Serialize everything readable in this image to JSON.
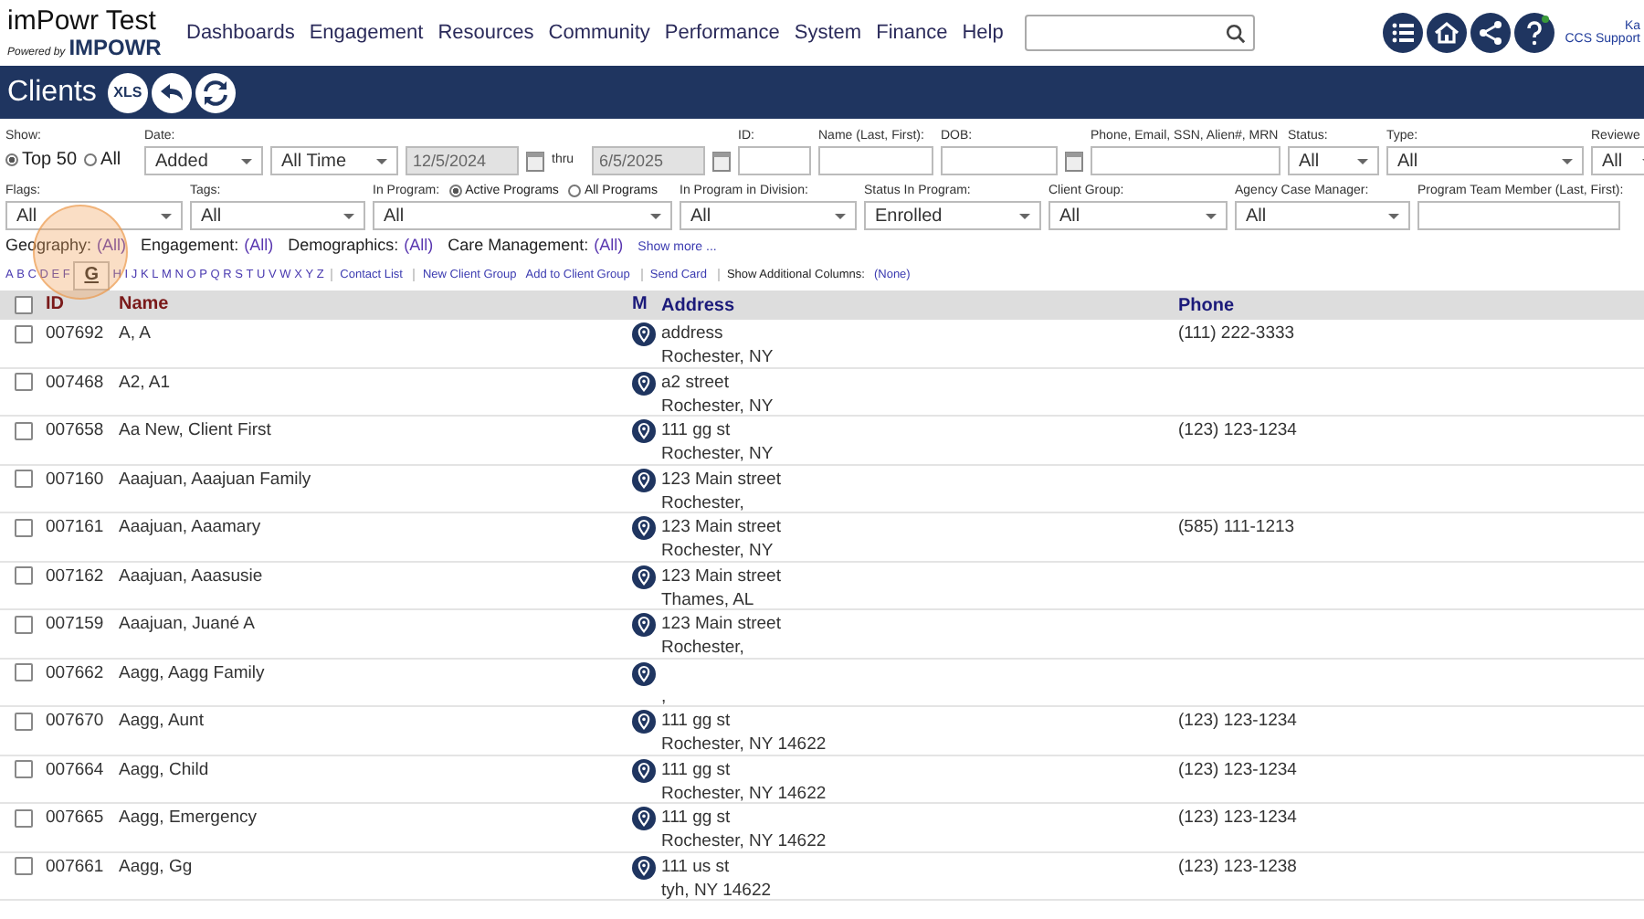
{
  "header": {
    "app_title": "imPowr Test",
    "powered_by": "Powered by",
    "brand": "IMPOWR",
    "nav": [
      "Dashboards",
      "Engagement",
      "Resources",
      "Community",
      "Performance",
      "System",
      "Finance",
      "Help"
    ],
    "user_name": "Ka",
    "user_org": "CCS Support"
  },
  "page_title": "Clients",
  "export_button": "XLS",
  "filters_row1": [
    {
      "kind": "radio",
      "label": "Show:",
      "options": [
        {
          "label": "Top 50",
          "selected": true
        },
        {
          "label": "All",
          "selected": false
        }
      ]
    },
    {
      "kind": "select",
      "label": "Date:",
      "value": "Added"
    },
    {
      "kind": "select",
      "value": "All Time"
    },
    {
      "kind": "date",
      "value": "12/5/2024",
      "disabled": true
    },
    {
      "kind": "text",
      "value": "thru"
    },
    {
      "kind": "date",
      "value": "6/5/2025",
      "disabled": true
    },
    {
      "kind": "input",
      "label": "ID:"
    },
    {
      "kind": "input",
      "label": "Name (Last, First):"
    },
    {
      "kind": "date",
      "label": "DOB:",
      "disabled": false
    },
    {
      "kind": "input",
      "label": "Phone, Email, SSN, Alien#, MRN"
    },
    {
      "kind": "select",
      "label": "Status:",
      "value": "All"
    },
    {
      "kind": "select",
      "label": "Type:",
      "value": "All"
    },
    {
      "kind": "select",
      "label": "Reviewe",
      "value": "All"
    }
  ],
  "filters_row2": [
    {
      "kind": "select",
      "label": "Flags:",
      "value": "All"
    },
    {
      "kind": "select",
      "label": "Tags:",
      "value": "All"
    },
    {
      "kind": "radio_select",
      "label": "In Program:",
      "options": [
        {
          "label": "Active Programs",
          "selected": true
        },
        {
          "label": "All Programs",
          "selected": false
        }
      ],
      "value": "All"
    },
    {
      "kind": "select",
      "label": "In Program in Division:",
      "value": "All"
    },
    {
      "kind": "select",
      "label": "Status In Program:",
      "value": "Enrolled"
    },
    {
      "kind": "select",
      "label": "Client Group:",
      "value": "All"
    },
    {
      "kind": "select",
      "label": "Agency Case Manager:",
      "value": "All"
    },
    {
      "kind": "input",
      "label": "Program Team Member (Last, First):"
    }
  ],
  "categories": [
    {
      "label": "Geography:",
      "value": "(All)"
    },
    {
      "label": "Engagement:",
      "value": "(All)"
    },
    {
      "label": "Demographics:",
      "value": "(All)"
    },
    {
      "label": "Care Management:",
      "value": "(All)"
    }
  ],
  "show_more": "Show more ...",
  "letters": [
    {
      "label": "A",
      "selected": false
    },
    {
      "label": "B",
      "selected": false
    },
    {
      "label": "C",
      "selected": false
    },
    {
      "label": "D",
      "selected": false
    },
    {
      "label": "E",
      "selected": false
    },
    {
      "label": "F",
      "selected": false
    },
    {
      "label": "G",
      "selected": true
    },
    {
      "label": "H",
      "selected": false
    },
    {
      "label": "I",
      "selected": false
    },
    {
      "label": "J",
      "selected": false
    },
    {
      "label": "K",
      "selected": false
    },
    {
      "label": "L",
      "selected": false
    },
    {
      "label": "M",
      "selected": false
    },
    {
      "label": "N",
      "selected": false
    },
    {
      "label": "O",
      "selected": false
    },
    {
      "label": "P",
      "selected": false
    },
    {
      "label": "Q",
      "selected": false
    },
    {
      "label": "R",
      "selected": false
    },
    {
      "label": "S",
      "selected": false
    },
    {
      "label": "T",
      "selected": false
    },
    {
      "label": "U",
      "selected": false
    },
    {
      "label": "V",
      "selected": false
    },
    {
      "label": "W",
      "selected": false
    },
    {
      "label": "X",
      "selected": false
    },
    {
      "label": "Y",
      "selected": false
    },
    {
      "label": "Z",
      "selected": false
    }
  ],
  "action_groups": [
    {
      "links": [
        "Contact List"
      ]
    },
    {
      "links": [
        "New Client Group",
        "Add to Client Group"
      ]
    },
    {
      "links": [
        "Send Card"
      ]
    }
  ],
  "additional_columns": {
    "label": "Show Additional Columns:",
    "value": "(None)"
  },
  "table": {
    "select_all_checked": false,
    "columns": [
      {
        "label": "ID",
        "sortable": true
      },
      {
        "label": "Name",
        "sortable": true
      },
      {
        "label": "M",
        "sortable": false
      },
      {
        "label": "Address",
        "sortable": false
      },
      {
        "label": "Phone",
        "sortable": false
      }
    ],
    "rows": [
      {
        "id": "007692",
        "name": "A, A",
        "street": "address",
        "city": "Rochester, NY",
        "phone": "(111) 222-3333",
        "checked": false
      },
      {
        "id": "007468",
        "name": "A2, A1",
        "street": "a2 street",
        "city": "Rochester, NY",
        "checked": false
      },
      {
        "id": "007658",
        "name": "Aa New, Client First",
        "street": "111 gg st",
        "city": "Rochester, NY",
        "phone": "(123) 123-1234",
        "checked": false
      },
      {
        "id": "007160",
        "name": "Aaajuan, Aaajuan Family",
        "street": "123 Main street",
        "city": "Rochester,",
        "checked": false
      },
      {
        "id": "007161",
        "name": "Aaajuan, Aaamary",
        "street": "123 Main street",
        "city": "Rochester, NY",
        "phone": "(585) 111-1213",
        "checked": false
      },
      {
        "id": "007162",
        "name": "Aaajuan, Aaasusie",
        "street": "123 Main street",
        "city": "Thames, AL",
        "checked": false
      },
      {
        "id": "007159",
        "name": "Aaajuan, Juané A",
        "street": "123 Main street",
        "city": "Rochester,",
        "checked": false
      },
      {
        "id": "007662",
        "name": "Aagg, Aagg Family",
        "city": ",",
        "checked": false
      },
      {
        "id": "007670",
        "name": "Aagg, Aunt",
        "street": "111 gg st",
        "city": "Rochester, NY 14622",
        "phone": "(123) 123-1234",
        "checked": false
      },
      {
        "id": "007664",
        "name": "Aagg, Child",
        "street": "111 gg st",
        "city": "Rochester, NY 14622",
        "phone": "(123) 123-1234",
        "checked": false
      },
      {
        "id": "007665",
        "name": "Aagg, Emergency",
        "street": "111 gg st",
        "city": "Rochester, NY 14622",
        "phone": "(123) 123-1234",
        "checked": false
      },
      {
        "id": "007661",
        "name": "Aagg, Gg",
        "street": "111 us st",
        "city": "tyh, NY 14622",
        "phone": "(123) 123-1238",
        "checked": false
      }
    ]
  }
}
